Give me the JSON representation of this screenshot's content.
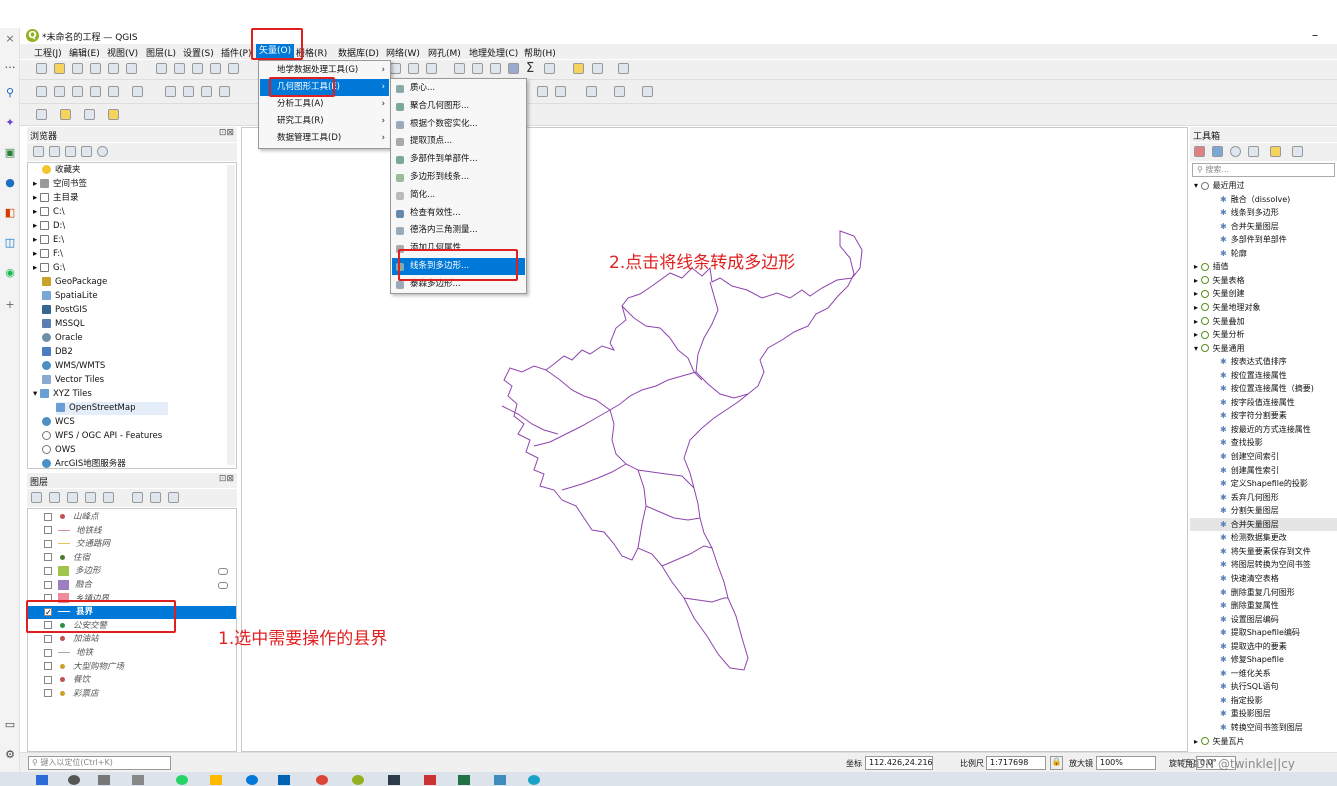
{
  "window": {
    "title": "*未命名的工程 — QGIS",
    "minimize_label": "–"
  },
  "left_strip": {
    "close_glyph": "×",
    "more_glyph": "…",
    "add_glyph": "+"
  },
  "menubar": [
    "工程(J)",
    "编辑(E)",
    "视图(V)",
    "图层(L)",
    "设置(S)",
    "插件(P)",
    "矢量(O)",
    "栅格(R)",
    "数据库(D)",
    "网络(W)",
    "网孔(M)",
    "地理处理(C)",
    "帮助(H)"
  ],
  "vector_menu": {
    "items": [
      "地学数据处理工具(G)",
      "几何图形工具(E)",
      "分析工具(A)",
      "研究工具(R)",
      "数据管理工具(D)"
    ]
  },
  "geometry_submenu": {
    "items": [
      "质心...",
      "聚合几何图形...",
      "根据个数密实化...",
      "提取顶点...",
      "多部件到单部件...",
      "多边形到线条...",
      "简化...",
      "检查有效性...",
      "德洛内三角测量...",
      "添加几何属性",
      "线条到多边形...",
      "泰森多边形..."
    ],
    "highlighted_index": 10
  },
  "browser_panel": {
    "title": "浏览器",
    "items": [
      "收藏夹",
      "空间书签",
      "主目录",
      "C:\\",
      "D:\\",
      "E:\\",
      "F:\\",
      "G:\\",
      "GeoPackage",
      "SpatiaLite",
      "PostGIS",
      "MSSQL",
      "Oracle",
      "DB2",
      "WMS/WMTS",
      "Vector Tiles",
      "XYZ Tiles",
      "OpenStreetMap",
      "WCS",
      "WFS / OGC API - Features",
      "OWS",
      "ArcGIS地图服务器",
      "ArcGIS要素服务器"
    ]
  },
  "layers_panel": {
    "title": "图层",
    "layers": [
      {
        "name": "山峰点",
        "checked": false,
        "selected": false,
        "italic": true,
        "color": "#c0504d",
        "symbol": "dot"
      },
      {
        "name": "地铁线",
        "checked": false,
        "selected": false,
        "italic": true,
        "color": "#d99694",
        "symbol": "line"
      },
      {
        "name": "交通路网",
        "checked": false,
        "selected": false,
        "italic": true,
        "color": "#f0c060",
        "symbol": "line"
      },
      {
        "name": "住宿",
        "checked": false,
        "selected": false,
        "italic": true,
        "color": "#4a7c2f",
        "symbol": "dot"
      },
      {
        "name": "多边形",
        "checked": false,
        "selected": false,
        "italic": true,
        "color": "#a3c44a",
        "symbol": "fill"
      },
      {
        "name": "融合",
        "checked": false,
        "selected": false,
        "italic": true,
        "color": "#9b7fc0",
        "symbol": "fill"
      },
      {
        "name": "乡镇边界",
        "checked": false,
        "selected": false,
        "italic": true,
        "color": "#f08a9a",
        "symbol": "fill"
      },
      {
        "name": "县界",
        "checked": true,
        "selected": true,
        "italic": false,
        "color": "#7b3fa0",
        "symbol": "line"
      },
      {
        "name": "公安交警",
        "checked": false,
        "selected": false,
        "italic": true,
        "color": "#2f8f3f",
        "symbol": "dot"
      },
      {
        "name": "加油站",
        "checked": false,
        "selected": false,
        "italic": true,
        "color": "#c0504d",
        "symbol": "dot"
      },
      {
        "name": "地铁",
        "checked": false,
        "selected": false,
        "italic": true,
        "color": "#aaaaaa",
        "symbol": "line"
      },
      {
        "name": "大型购物广场",
        "checked": false,
        "selected": false,
        "italic": true,
        "color": "#c9a22a",
        "symbol": "dot"
      },
      {
        "name": "餐饮",
        "checked": false,
        "selected": false,
        "italic": true,
        "color": "#c0504d",
        "symbol": "dot"
      },
      {
        "name": "彩票店",
        "checked": false,
        "selected": false,
        "italic": true,
        "color": "#c9a22a",
        "symbol": "dot"
      }
    ]
  },
  "toolbox": {
    "title": "工具箱",
    "search_placeholder": "搜索...",
    "items": [
      {
        "label": "最近用过",
        "level": 0
      },
      {
        "label": "融合（dissolve)",
        "level": 1
      },
      {
        "label": "线条到多边形",
        "level": 1
      },
      {
        "label": "合并矢量图层",
        "level": 1
      },
      {
        "label": "多部件到单部件",
        "level": 1
      },
      {
        "label": "轮廓",
        "level": 1
      },
      {
        "label": "插值",
        "level": 0
      },
      {
        "label": "矢量表格",
        "level": 0
      },
      {
        "label": "矢量创建",
        "level": 0
      },
      {
        "label": "矢量地理对象",
        "level": 0
      },
      {
        "label": "矢量叠加",
        "level": 0
      },
      {
        "label": "矢量分析",
        "level": 0
      },
      {
        "label": "矢量通用",
        "level": 0
      },
      {
        "label": "按表达式值排序",
        "level": 1
      },
      {
        "label": "按位置连接属性",
        "level": 1
      },
      {
        "label": "按位置连接属性（摘要)",
        "level": 1
      },
      {
        "label": "按字段值连接属性",
        "level": 1
      },
      {
        "label": "按字符分割要素",
        "level": 1
      },
      {
        "label": "按最近的方式连接属性",
        "level": 1
      },
      {
        "label": "查找投影",
        "level": 1
      },
      {
        "label": "创建空间索引",
        "level": 1
      },
      {
        "label": "创建属性索引",
        "level": 1
      },
      {
        "label": "定义Shapefile的投影",
        "level": 1
      },
      {
        "label": "丢弃几何图形",
        "level": 1
      },
      {
        "label": "分割矢量图层",
        "level": 1
      },
      {
        "label": "合并矢量图层",
        "level": 1
      },
      {
        "label": "检测数据集更改",
        "level": 1
      },
      {
        "label": "将矢量要素保存到文件",
        "level": 1
      },
      {
        "label": "将图层转换为空间书签",
        "level": 1
      },
      {
        "label": "快速清空表格",
        "level": 1
      },
      {
        "label": "删除重复几何图形",
        "level": 1
      },
      {
        "label": "删除重复属性",
        "level": 1
      },
      {
        "label": "设置图层编码",
        "level": 1
      },
      {
        "label": "提取Shapefile编码",
        "level": 1
      },
      {
        "label": "提取选中的要素",
        "level": 1
      },
      {
        "label": "修复Shapefile",
        "level": 1
      },
      {
        "label": "一维化关系",
        "level": 1
      },
      {
        "label": "执行SQL语句",
        "level": 1
      },
      {
        "label": "指定投影",
        "level": 1
      },
      {
        "label": "重投影图层",
        "level": 1
      },
      {
        "label": "转换空间书签到图层",
        "level": 1
      },
      {
        "label": "矢量瓦片",
        "level": 0
      }
    ]
  },
  "annotations": {
    "step1": "1.选中需要操作的县界",
    "step2": "2.点击将线条转成多边形"
  },
  "statusbar": {
    "locate_placeholder": "键入以定位(Ctrl+K)",
    "coord_label": "坐标",
    "coord_value": "112.426,24.216",
    "scale_label": "比例尺",
    "scale_value": "1:717698",
    "magnifier_label": "放大镜",
    "magnifier_value": "100%",
    "rotation_label": "旋转角度",
    "rotation_value": "0.0°",
    "watermark": "CSDN @twinkle||cy"
  },
  "colors": {
    "highlight": "#0078d7",
    "annotation": "#e02020",
    "map_line": "#8e44ad"
  }
}
